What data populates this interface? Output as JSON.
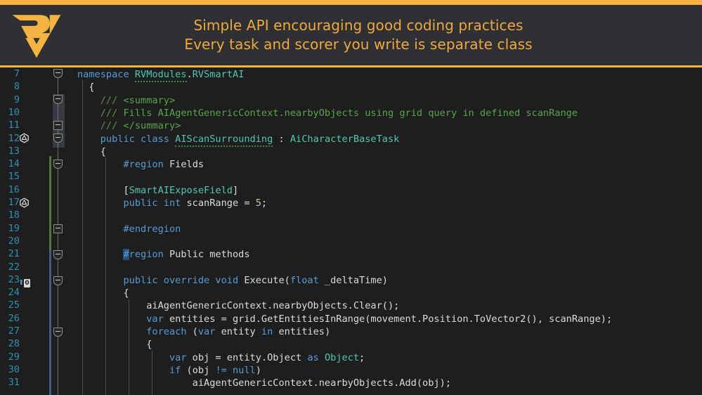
{
  "header": {
    "logo_alt": "RV logo",
    "accent_color": "#f5b342",
    "text_color": "#f0a93b",
    "background": "#2e3033",
    "lines": [
      "Simple API encouraging good coding practices",
      "Every task and scorer you write is separate class"
    ]
  },
  "editor": {
    "background": "#1e1e1e",
    "line_number_color": "#2b91af",
    "first_line_number": 7,
    "last_line_number": 31,
    "line_numbers": [
      7,
      8,
      9,
      10,
      11,
      12,
      13,
      14,
      15,
      16,
      17,
      18,
      19,
      20,
      21,
      22,
      23,
      24,
      25,
      26,
      27,
      28,
      29,
      30,
      31
    ],
    "gutter_markers": [
      {
        "line": 12,
        "icon": "unity-icon"
      },
      {
        "line": 17,
        "icon": "unity-icon"
      },
      {
        "line": 23,
        "icon": "code-lens-reference",
        "label": "0"
      }
    ],
    "cursor": {
      "line": 21,
      "column": 1,
      "selection_color": "#264f78"
    },
    "lines": [
      {
        "n": 7,
        "text": "namespace RVModules.RVSmartAI"
      },
      {
        "n": 8,
        "text": "{"
      },
      {
        "n": 9,
        "text": "    /// <summary>"
      },
      {
        "n": 10,
        "text": "    /// Fills AIAgentGenericContext.nearbyObjects using grid query in defined scanRange"
      },
      {
        "n": 11,
        "text": "    /// </summary>"
      },
      {
        "n": 12,
        "text": "    public class AIScanSurrounding : AiCharacterBaseTask"
      },
      {
        "n": 13,
        "text": "    {"
      },
      {
        "n": 14,
        "text": "        #region Fields"
      },
      {
        "n": 15,
        "text": ""
      },
      {
        "n": 16,
        "text": "        [SmartAIExposeField]"
      },
      {
        "n": 17,
        "text": "        public int scanRange = 5;"
      },
      {
        "n": 18,
        "text": ""
      },
      {
        "n": 19,
        "text": "        #endregion"
      },
      {
        "n": 20,
        "text": ""
      },
      {
        "n": 21,
        "text": "        #region Public methods"
      },
      {
        "n": 22,
        "text": ""
      },
      {
        "n": 23,
        "text": "        public override void Execute(float _deltaTime)"
      },
      {
        "n": 24,
        "text": "        {"
      },
      {
        "n": 25,
        "text": "            aiAgentGenericContext.nearbyObjects.Clear();"
      },
      {
        "n": 26,
        "text": "            var entities = grid.GetEntitiesInRange(movement.Position.ToVector2(), scanRange);"
      },
      {
        "n": 27,
        "text": "            foreach (var entity in entities)"
      },
      {
        "n": 28,
        "text": "            {"
      },
      {
        "n": 29,
        "text": "                var obj = entity.Object as Object;"
      },
      {
        "n": 30,
        "text": "                if (obj != null)"
      },
      {
        "n": 31,
        "text": "                    aiAgentGenericContext.nearbyObjects.Add(obj);"
      }
    ],
    "syntax_colors": {
      "keyword": "#569cd6",
      "comment": "#57a64a",
      "type": "#4ec9b0",
      "plain": "#dcdcdc",
      "number": "#b5cea8",
      "preprocessor_text": "#9b9b9b"
    },
    "change_bars": [
      {
        "from_line": 14,
        "to_line": 22,
        "color": "#4c7a3f",
        "state": "modified"
      },
      {
        "from_line": 21,
        "to_line": 31,
        "color": "#3f5e83",
        "state": "saved"
      }
    ]
  }
}
